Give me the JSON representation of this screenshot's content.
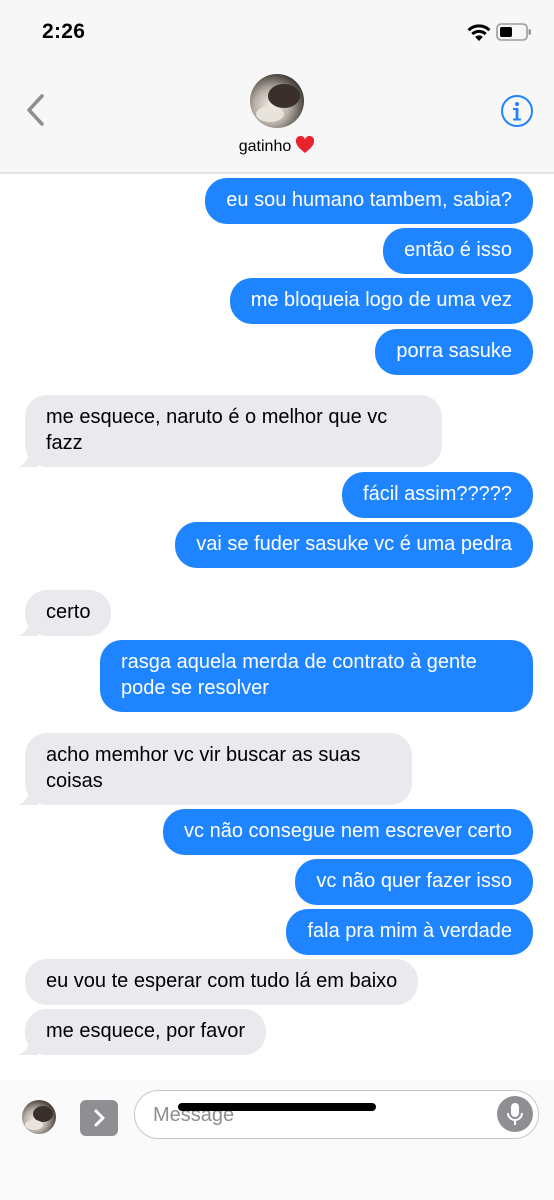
{
  "status_bar": {
    "time": "2:26"
  },
  "header": {
    "contact_name": "gatinho"
  },
  "messages": [
    {
      "side": "out",
      "text": "eu sou humano tambem, sabia?"
    },
    {
      "side": "out",
      "text": "então é isso"
    },
    {
      "side": "out",
      "text": "me bloqueia logo de uma vez"
    },
    {
      "side": "out",
      "text": "porra sasuke"
    },
    {
      "side": "in",
      "lines": [
        "me esquece, naruto é o melhor que vc",
        "fazz"
      ]
    },
    {
      "side": "out",
      "text": "fácil assim?????"
    },
    {
      "side": "out",
      "text": "vai se fuder sasuke vc é uma pedra"
    },
    {
      "side": "in",
      "text": "certo"
    },
    {
      "side": "out",
      "lines": [
        "rasga aquela merda de contrato à gente",
        "pode se resolver"
      ]
    },
    {
      "side": "in",
      "lines": [
        "acho memhor vc vir buscar as suas",
        "coisas"
      ]
    },
    {
      "side": "out",
      "text": "vc não consegue nem escrever certo"
    },
    {
      "side": "out",
      "text": "vc não quer fazer isso"
    },
    {
      "side": "out",
      "text": "fala pra mim à verdade"
    },
    {
      "side": "in",
      "text": "eu vou te esperar com tudo lá em baixo"
    },
    {
      "side": "in",
      "text": "me esquece, por favor"
    }
  ],
  "composer": {
    "placeholder": "Message",
    "value": ""
  },
  "colors": {
    "outgoing": "#1f84ff",
    "incoming": "#e9e9ee",
    "accent": "#1f84ff"
  }
}
